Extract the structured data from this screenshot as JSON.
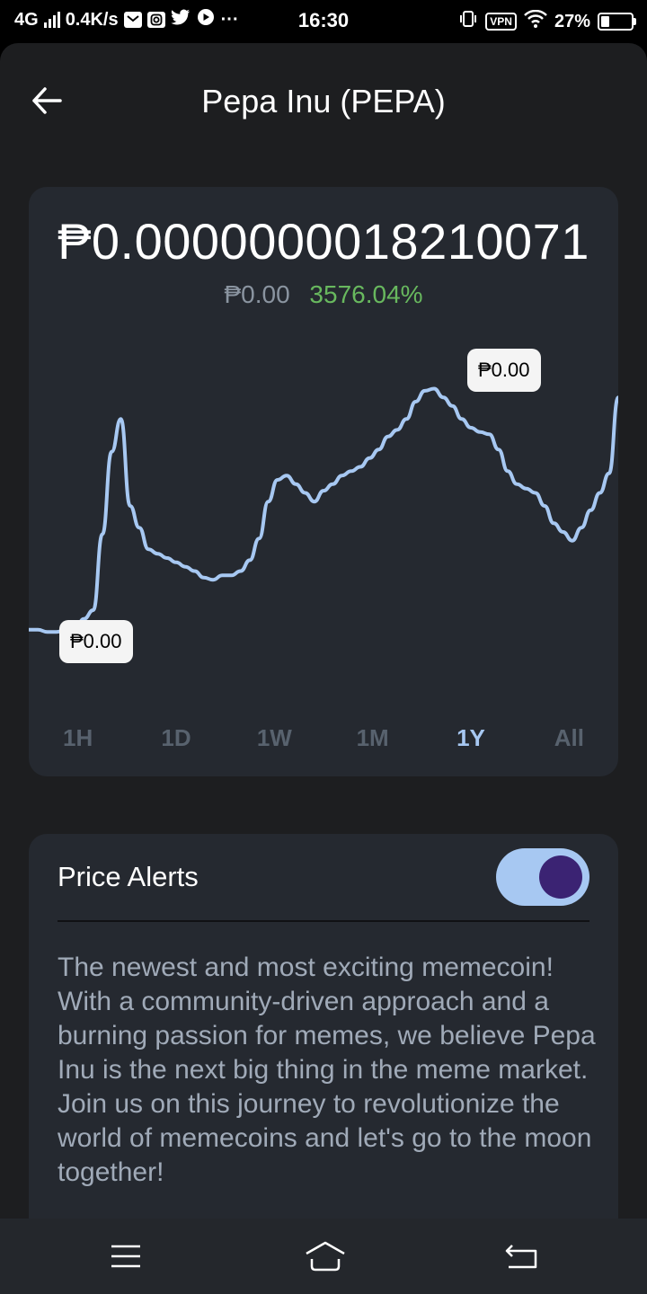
{
  "status_bar": {
    "network": "4G",
    "speed": "0.4K/s",
    "dots": "···",
    "time": "16:30",
    "vpn": "VPN",
    "battery": "27%",
    "icons": [
      "signal-icon",
      "mail-icon",
      "instagram-icon",
      "twitter-icon",
      "youtube-icon",
      "vibrate-icon",
      "vpn-icon",
      "wifi-icon",
      "battery-icon"
    ]
  },
  "header": {
    "title": "Pepa Inu (PEPA)",
    "back_icon": "arrow-left-icon"
  },
  "price_card": {
    "price": "₱0.0000000018210071",
    "change_abs": "₱0.00",
    "change_pct": "3576.04%",
    "tooltip_high": "₱0.00",
    "tooltip_low": "₱0.00",
    "line_color": "#a7c8f2",
    "ranges": [
      "1H",
      "1D",
      "1W",
      "1M",
      "1Y",
      "All"
    ],
    "selected_range": "1Y"
  },
  "chart_data": {
    "type": "line",
    "title": "",
    "xlabel": "",
    "ylabel": "",
    "x": [
      0,
      1,
      2,
      3,
      4,
      5,
      6,
      7,
      8,
      9,
      10,
      11,
      12,
      13,
      14,
      15,
      16,
      17,
      18,
      19,
      20,
      21,
      22,
      23,
      24,
      25,
      26,
      27,
      28,
      29,
      30,
      31,
      32,
      33,
      34,
      35,
      36,
      37,
      38,
      39,
      40,
      41,
      42,
      43,
      44,
      45,
      46,
      47,
      48,
      49,
      50,
      51,
      52,
      53,
      54,
      55,
      56,
      57,
      58,
      59,
      60,
      61,
      62,
      63,
      64
    ],
    "values": [
      3,
      3,
      2,
      2,
      3,
      3,
      8,
      12,
      47,
      85,
      100,
      60,
      50,
      40,
      38,
      36,
      34,
      32,
      30,
      27,
      26,
      28,
      28,
      30,
      35,
      45,
      62,
      72,
      74,
      70,
      66,
      62,
      67,
      70,
      74,
      76,
      78,
      82,
      86,
      92,
      95,
      100,
      108,
      113,
      114,
      110,
      106,
      100,
      96,
      94,
      93,
      86,
      76,
      70,
      68,
      66,
      60,
      52,
      48,
      44,
      50,
      58,
      66,
      75,
      110
    ],
    "ylim": [
      0,
      120
    ]
  },
  "alerts": {
    "label": "Price Alerts",
    "enabled": true,
    "description": "The newest and most exciting memecoin! With a community-driven approach and a burning passion for memes, we believe Pepa Inu is the next big thing in the meme market. Join us on this journey to revolutionize the world of memecoins and let's go to the moon together!"
  },
  "nav": {
    "icons": [
      "menu-icon",
      "home-icon",
      "back-icon"
    ]
  }
}
